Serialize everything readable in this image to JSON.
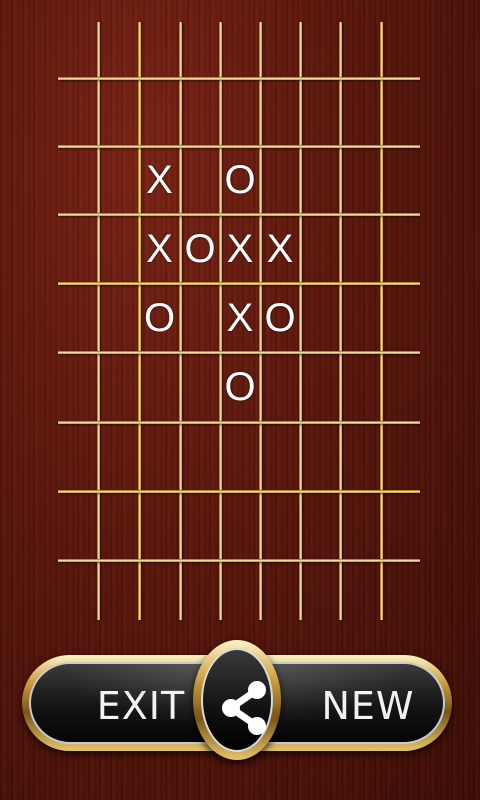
{
  "board": {
    "marks": [
      {
        "row": 0,
        "col": 0,
        "symbol": "X"
      },
      {
        "row": 0,
        "col": 2,
        "symbol": "O"
      },
      {
        "row": 1,
        "col": 0,
        "symbol": "X"
      },
      {
        "row": 1,
        "col": 1,
        "symbol": "O"
      },
      {
        "row": 1,
        "col": 2,
        "symbol": "X"
      },
      {
        "row": 1,
        "col": 3,
        "symbol": "X"
      },
      {
        "row": 2,
        "col": 0,
        "symbol": "O"
      },
      {
        "row": 2,
        "col": 2,
        "symbol": "X"
      },
      {
        "row": 2,
        "col": 3,
        "symbol": "O"
      },
      {
        "row": 3,
        "col": 2,
        "symbol": "O"
      }
    ]
  },
  "controls": {
    "exit_label": "EXIT",
    "new_label": "NEW",
    "share_icon": "share-icon"
  },
  "colors": {
    "grid_gold": "#e8c25a",
    "mark_white": "#ffffff",
    "bar_black": "#141414"
  }
}
